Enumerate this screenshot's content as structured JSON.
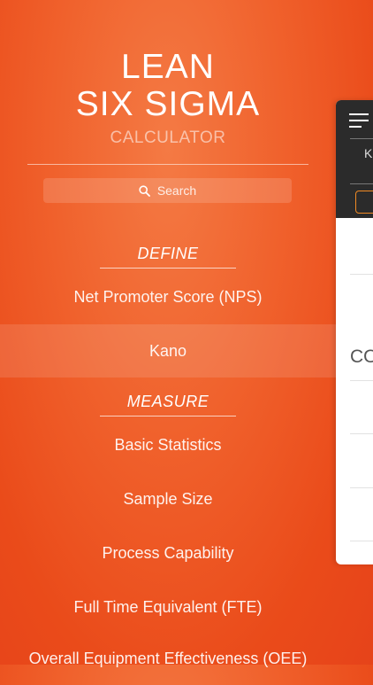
{
  "logo": {
    "line1": "LEAN",
    "line2": "SIX SIGMA",
    "line3": "CALCULATOR"
  },
  "search": {
    "placeholder": "Search"
  },
  "sections": [
    {
      "title": "DEFINE",
      "items": [
        "Net Promoter Score (NPS)",
        "Kano"
      ]
    },
    {
      "title": "MEASURE",
      "items": [
        "Basic Statistics",
        "Sample Size",
        "Process Capability",
        "Full Time Equivalent (FTE)",
        "Overall Equipment Effectiveness (OEE)"
      ]
    }
  ],
  "selected_item": "Kano",
  "panel": {
    "header_letter": "K",
    "body_text": "CO"
  }
}
